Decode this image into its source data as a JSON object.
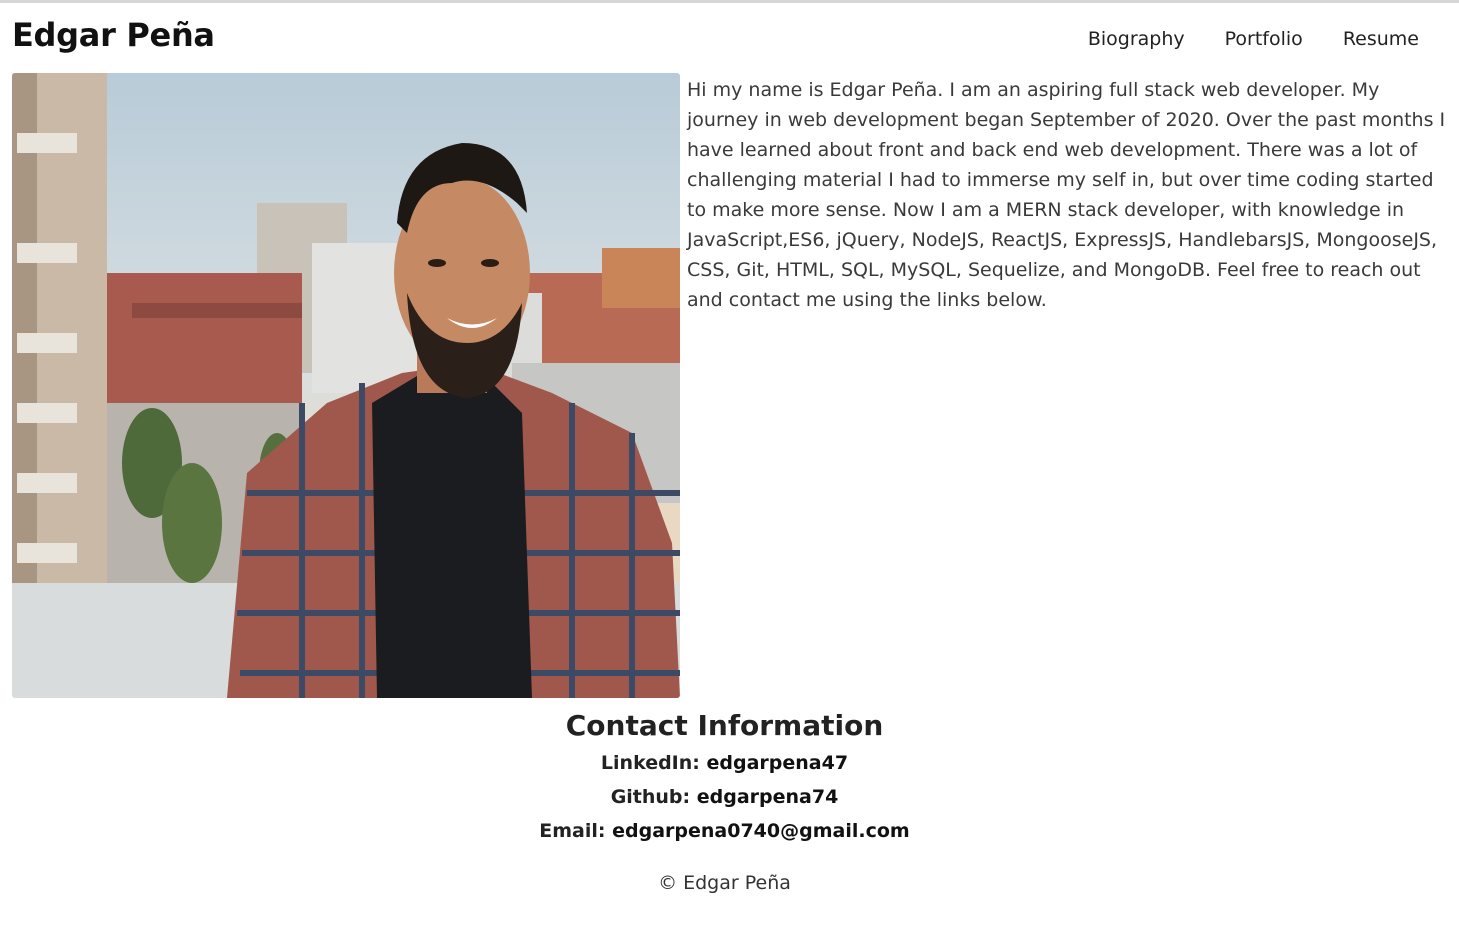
{
  "header": {
    "brand": "Edgar Peña",
    "nav": [
      {
        "label": "Biography"
      },
      {
        "label": "Portfolio"
      },
      {
        "label": "Resume"
      }
    ]
  },
  "main": {
    "photo_alt": "Edgar Peña",
    "bio": "Hi my name is Edgar Peña. I am an aspiring full stack web developer. My journey in web development began September of 2020. Over the past months I have learned about front and back end web development. There was a lot of challenging material I had to immerse my self in, but over time coding started to make more sense. Now I am a MERN stack developer, with knowledge in JavaScript,ES6, jQuery, NodeJS, ReactJS, ExpressJS, HandlebarsJS, MongooseJS, CSS, Git, HTML, SQL, MySQL, Sequelize, and MongoDB. Feel free to reach out and contact me using the links below."
  },
  "contact": {
    "title": "Contact Information",
    "linkedin_label": "LinkedIn: ",
    "linkedin_value": "edgarpena47",
    "github_label": "Github: ",
    "github_value": "edgarpena74",
    "email_label": "Email: ",
    "email_value": "edgarpena0740@gmail.com"
  },
  "footer": {
    "copyright": "© Edgar Peña"
  }
}
